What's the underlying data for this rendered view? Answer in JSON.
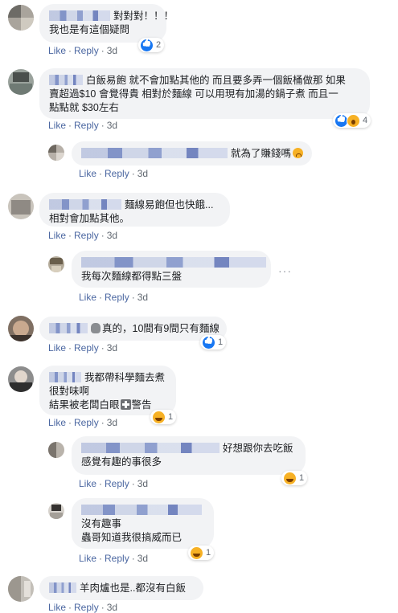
{
  "actions": {
    "like": "Like",
    "reply": "Reply",
    "sep": "·"
  },
  "comments": [
    {
      "text": [
        "對對對！！！",
        "我也是有這個疑問"
      ],
      "time": "3d",
      "reactions": {
        "count": "2"
      }
    },
    {
      "text": [
        "白飯易飽 就不會加點其他的 而且要多弄一個飯桶做那 如果",
        "賣超過$10 會覺得貴 相對於麵線 可以用現有加湯的鍋子煮 而且一",
        "點點就 $30左右"
      ],
      "time": "3d",
      "reactions": {
        "count": "4"
      }
    },
    {
      "text": [
        "就為了賺錢嗎"
      ],
      "time": "3d"
    },
    {
      "text": [
        "麵線易飽但也快餓...",
        "相對會加點其他。"
      ],
      "time": "3d"
    },
    {
      "text": [
        "我每次麵線都得點三盤"
      ],
      "time": "3d"
    },
    {
      "text": [
        "真的，10間有9間只有麵線"
      ],
      "time": "3d",
      "reactions": {
        "count": "1"
      }
    },
    {
      "text": [
        "我都帶科學麵去煮",
        "很對味啊",
        "結果被老闆白眼",
        "警告"
      ],
      "time": "3d",
      "reactions": {
        "count": "1"
      }
    },
    {
      "text": [
        "好想跟你去吃飯",
        "感覺有趣的事很多"
      ],
      "time": "3d",
      "reactions": {
        "count": "1"
      }
    },
    {
      "text": [
        "沒有趣事",
        "蟲哥知道我很搞威而已"
      ],
      "time": "3d",
      "reactions": {
        "count": "1"
      }
    },
    {
      "text": [
        "羊肉爐也是..都沒有白飯"
      ],
      "time": "3d"
    }
  ],
  "colors": {
    "link": "#4b67a1",
    "bubble": "#f2f3f5",
    "like": "#1877f2",
    "haha": "#f7b125"
  }
}
